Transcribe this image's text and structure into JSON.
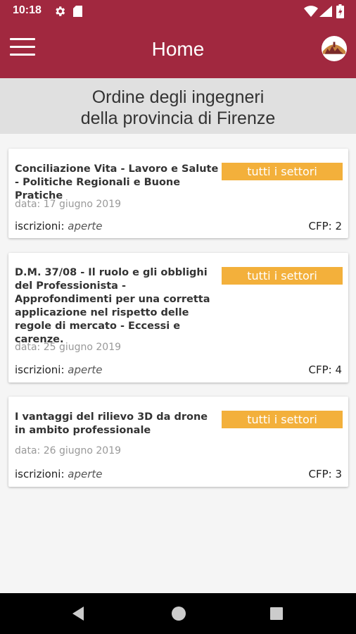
{
  "status": {
    "time": "10:18"
  },
  "appbar": {
    "title": "Home"
  },
  "org": {
    "line1": "Ordine degli ingegneri",
    "line2": "della provincia di Firenze"
  },
  "events": [
    {
      "title": "Conciliazione Vita - Lavoro e Salute - Politiche Regionali e Buone Pratiche",
      "sector": "tutti i settori",
      "date": "data: 17 giugno 2019",
      "reg_label": "iscrizioni:",
      "reg_status": "aperte",
      "cfp": "CFP: 2"
    },
    {
      "title": "D.M. 37/08 - Il ruolo e gli obblighi del Professionista - Approfondimenti per una corretta applicazione nel rispetto delle regole di mercato - Eccessi e carenze.",
      "sector": "tutti i settori",
      "date": "data: 25 giugno 2019",
      "reg_label": "iscrizioni:",
      "reg_status": "aperte",
      "cfp": "CFP: 4"
    },
    {
      "title": "I vantaggi del rilievo 3D da drone in ambito professionale",
      "sector": "tutti i settori",
      "date": "data: 26 giugno 2019",
      "reg_label": "iscrizioni:",
      "reg_status": "aperte",
      "cfp": "CFP: 3"
    }
  ],
  "colors": {
    "primary": "#a1283f",
    "badge": "#f3b03b",
    "header_band": "#e0e0e0"
  }
}
